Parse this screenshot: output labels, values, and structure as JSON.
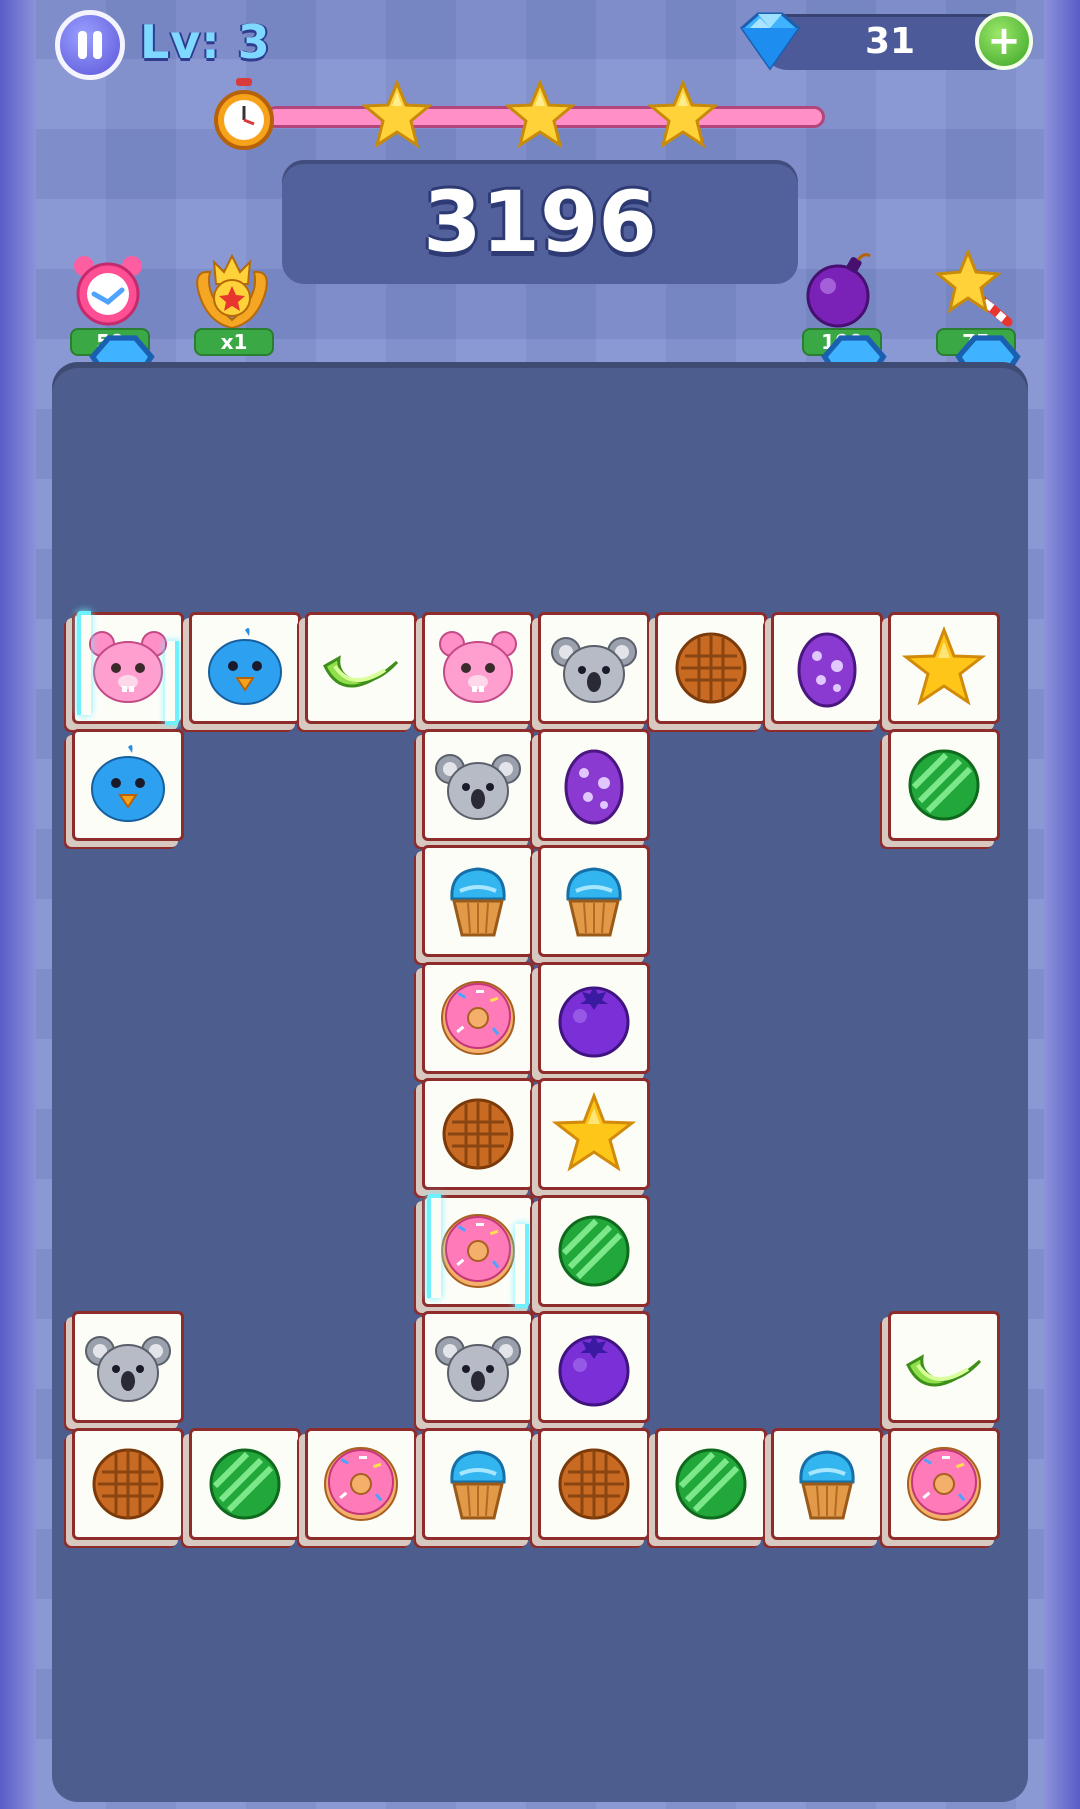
{
  "header": {
    "level_label": "Lv: 3",
    "gem_count": "31"
  },
  "progress": {
    "fill_fraction": 1.0,
    "stars_earned": 3
  },
  "score": {
    "value": "3196"
  },
  "boosters": [
    {
      "name": "alarm-clock",
      "cost": "50"
    },
    {
      "name": "crown-multiplier",
      "cost": "x1"
    },
    {
      "name": "bomb",
      "cost": "100"
    },
    {
      "name": "magic-wand",
      "cost": "75"
    }
  ],
  "board": {
    "tiles": [
      {
        "row": 0,
        "col": 0,
        "icon": "pink-bear",
        "selected": true
      },
      {
        "row": 0,
        "col": 1,
        "icon": "blue-bird"
      },
      {
        "row": 0,
        "col": 2,
        "icon": "lime-slice"
      },
      {
        "row": 0,
        "col": 3,
        "icon": "pink-bear"
      },
      {
        "row": 0,
        "col": 4,
        "icon": "koala"
      },
      {
        "row": 0,
        "col": 5,
        "icon": "waffle-cookie"
      },
      {
        "row": 0,
        "col": 6,
        "icon": "purple-egg"
      },
      {
        "row": 0,
        "col": 7,
        "icon": "yellow-star"
      },
      {
        "row": 1,
        "col": 0,
        "icon": "blue-bird"
      },
      {
        "row": 1,
        "col": 3,
        "icon": "koala"
      },
      {
        "row": 1,
        "col": 4,
        "icon": "purple-egg"
      },
      {
        "row": 1,
        "col": 7,
        "icon": "green-candy"
      },
      {
        "row": 2,
        "col": 3,
        "icon": "cupcake"
      },
      {
        "row": 2,
        "col": 4,
        "icon": "cupcake"
      },
      {
        "row": 3,
        "col": 3,
        "icon": "pink-donut"
      },
      {
        "row": 3,
        "col": 4,
        "icon": "blueberry"
      },
      {
        "row": 4,
        "col": 3,
        "icon": "waffle-cookie"
      },
      {
        "row": 4,
        "col": 4,
        "icon": "yellow-star"
      },
      {
        "row": 5,
        "col": 3,
        "icon": "pink-donut",
        "selected": true
      },
      {
        "row": 5,
        "col": 4,
        "icon": "green-candy"
      },
      {
        "row": 6,
        "col": 0,
        "icon": "koala"
      },
      {
        "row": 6,
        "col": 3,
        "icon": "koala"
      },
      {
        "row": 6,
        "col": 4,
        "icon": "blueberry"
      },
      {
        "row": 6,
        "col": 7,
        "icon": "lime-slice"
      },
      {
        "row": 7,
        "col": 0,
        "icon": "waffle-cookie"
      },
      {
        "row": 7,
        "col": 1,
        "icon": "green-candy"
      },
      {
        "row": 7,
        "col": 2,
        "icon": "pink-donut"
      },
      {
        "row": 7,
        "col": 3,
        "icon": "cupcake"
      },
      {
        "row": 7,
        "col": 4,
        "icon": "waffle-cookie"
      },
      {
        "row": 7,
        "col": 5,
        "icon": "green-candy"
      },
      {
        "row": 7,
        "col": 6,
        "icon": "cupcake"
      },
      {
        "row": 7,
        "col": 7,
        "icon": "pink-donut"
      }
    ]
  },
  "colors": {
    "board": "#4c5d8e",
    "tile_border": "#8e2c2c",
    "progress": "#f06ba8",
    "selection_glow": "#6ff0ff"
  }
}
